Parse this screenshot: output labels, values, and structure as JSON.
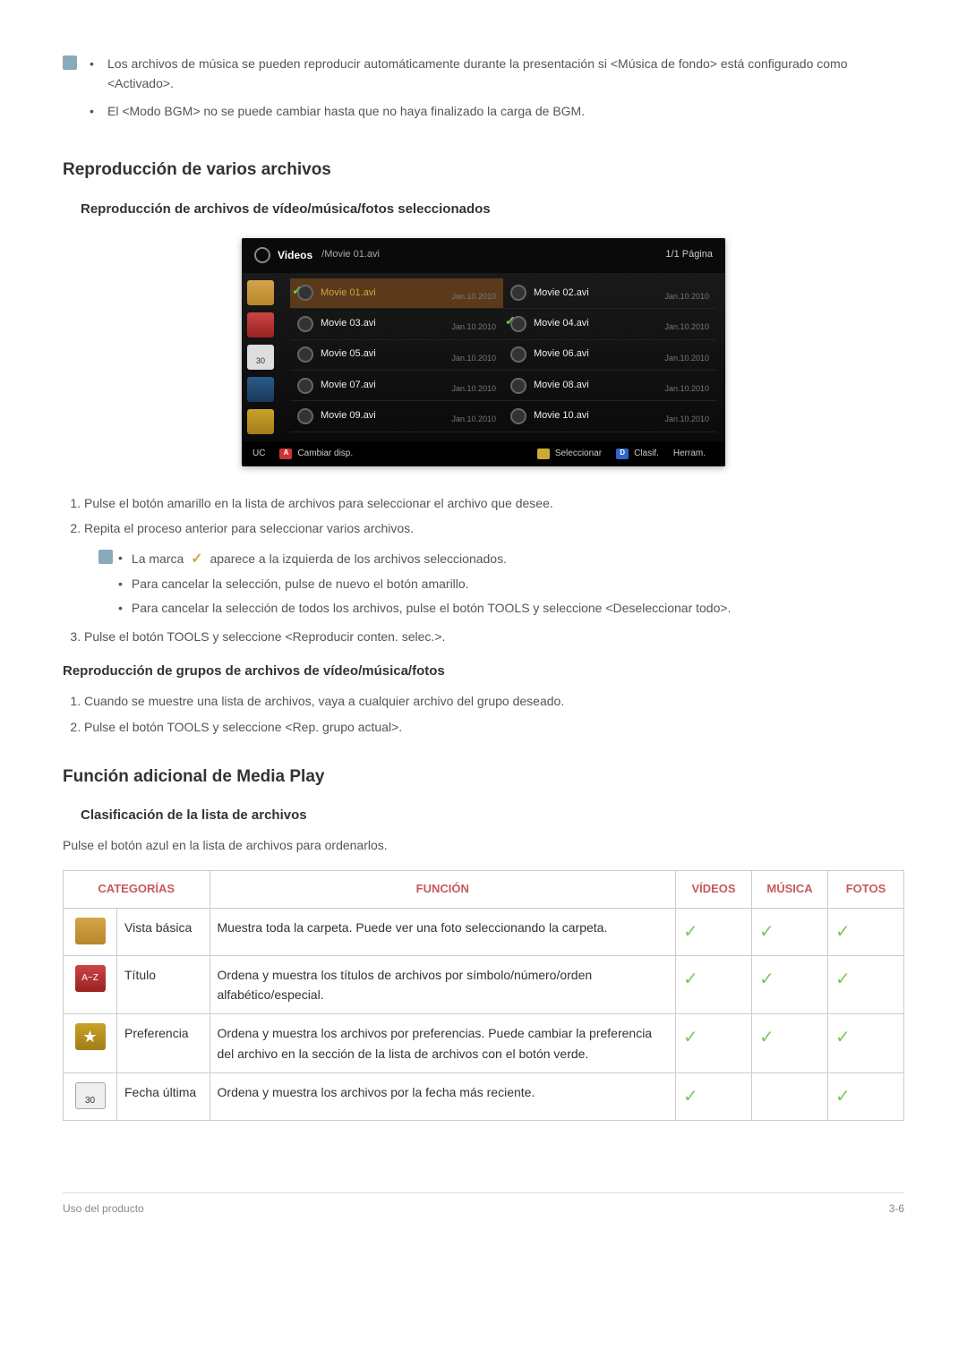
{
  "notes_top": [
    "Los archivos de música se pueden reproducir automáticamente durante la presentación si <Música de fondo> está configurado como <Activado>.",
    "El <Modo BGM> no se puede cambiar hasta que no haya finalizado la carga de BGM."
  ],
  "h2_1": "Reproducción de varios archivos",
  "h3_1": "Reproducción de archivos de vídeo/música/fotos seleccionados",
  "screenshot": {
    "title": "Videos",
    "path": "/Movie 01.avi",
    "page": "1/1 Página",
    "files": [
      {
        "name": "Movie 01.avi",
        "date": "Jan.10.2010",
        "selected": true,
        "checked": true
      },
      {
        "name": "Movie 02.avi",
        "date": "Jan.10.2010"
      },
      {
        "name": "Movie 03.avi",
        "date": "Jan.10.2010"
      },
      {
        "name": "Movie 04.avi",
        "date": "Jan.10.2010",
        "checked": true
      },
      {
        "name": "Movie 05.avi",
        "date": "Jan.10.2010"
      },
      {
        "name": "Movie 06.avi",
        "date": "Jan.10.2010"
      },
      {
        "name": "Movie 07.avi",
        "date": "Jan.10.2010"
      },
      {
        "name": "Movie 08.avi",
        "date": "Jan.10.2010"
      },
      {
        "name": "Movie 09.avi",
        "date": "Jan.10.2010"
      },
      {
        "name": "Movie 10.avi",
        "date": "Jan.10.2010"
      }
    ],
    "sb_date": "30",
    "footer": {
      "uc": "UC",
      "a": "A",
      "a_label": "Cambiar disp.",
      "c_label": "Seleccionar",
      "d": "D",
      "d_label": "Clasif.",
      "tools_label": "Herram."
    }
  },
  "ol1": [
    "Pulse el botón amarillo en la lista de archivos para seleccionar el archivo que desee.",
    "Repita el proceso anterior para seleccionar varios archivos."
  ],
  "sub_notes": {
    "line1a": "La marca",
    "line1b": "aparece a la izquierda de los archivos seleccionados.",
    "line2": "Para cancelar la selección, pulse de nuevo el botón amarillo.",
    "line3": "Para cancelar la selección de todos los archivos, pulse el botón TOOLS y seleccione <Deseleccionar todo>."
  },
  "ol1_3": "Pulse el botón TOOLS y seleccione <Reproducir conten. selec.>.",
  "h3_2": "Reproducción de grupos de archivos de vídeo/música/fotos",
  "ol2": [
    "Cuando se muestre una lista de archivos, vaya a cualquier archivo del grupo deseado.",
    "Pulse el botón TOOLS y seleccione <Rep. grupo actual>."
  ],
  "h2_2": "Función adicional de Media Play",
  "h3_3": "Clasificación de la lista de archivos",
  "intro": "Pulse el botón azul en la lista de archivos para ordenarlos.",
  "table": {
    "headers": {
      "cat": "CATEGORÍAS",
      "func": "FUNCIÓN",
      "vid": "VÍDEOS",
      "mus": "MÚSICA",
      "fot": "FOTOS"
    },
    "rows": [
      {
        "name": "Vista básica",
        "desc": "Muestra toda la carpeta. Puede ver una foto seleccionando la carpeta.",
        "v": true,
        "m": true,
        "f": true,
        "icon": "folder"
      },
      {
        "name": "Título",
        "desc": "Ordena y muestra los títulos de archivos por símbolo/número/orden alfabético/especial.",
        "v": true,
        "m": true,
        "f": true,
        "icon": "az"
      },
      {
        "name": "Preferencia",
        "desc": "Ordena y muestra los archivos por preferencias. Puede cambiar la preferencia del archivo en la sección de la lista de archivos con el botón verde.",
        "v": true,
        "m": true,
        "f": true,
        "icon": "star"
      },
      {
        "name": "Fecha última",
        "desc": "Ordena y muestra los archivos por la fecha más reciente.",
        "v": true,
        "m": false,
        "f": true,
        "icon": "date",
        "icon_label": "30"
      }
    ]
  },
  "footer": {
    "left": "Uso del producto",
    "right": "3-6"
  }
}
